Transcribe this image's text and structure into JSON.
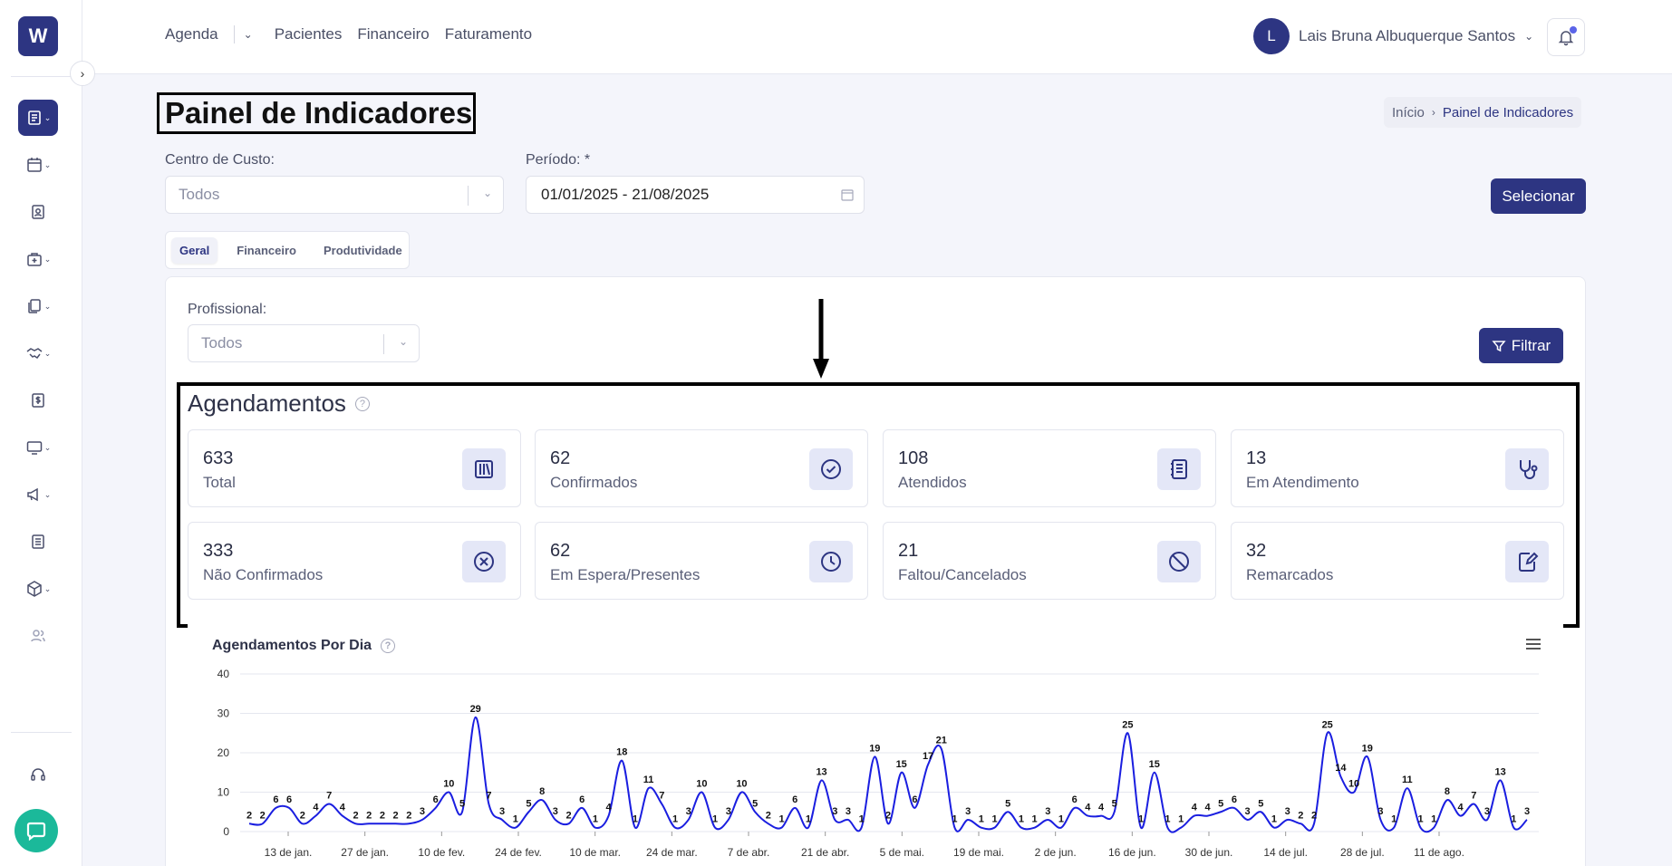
{
  "app": {
    "logo_letter": "W"
  },
  "topnav": {
    "agenda": "Agenda",
    "pacientes": "Pacientes",
    "financeiro": "Financeiro",
    "faturamento": "Faturamento"
  },
  "user": {
    "initial": "L",
    "name": "Lais Bruna Albuquerque Santos"
  },
  "page": {
    "title": "Painel de Indicadores"
  },
  "breadcrumb": {
    "home": "Início",
    "current": "Painel de Indicadores"
  },
  "filters": {
    "centro_label": "Centro de Custo:",
    "centro_value": "Todos",
    "periodo_label": "Período: *",
    "periodo_value": "01/01/2025 - 21/08/2025",
    "selecionar": "Selecionar",
    "profissional_label": "Profissional:",
    "profissional_value": "Todos",
    "filtrar": "Filtrar"
  },
  "tabs": [
    "Geral",
    "Financeiro",
    "Produtividade"
  ],
  "section": {
    "title": "Agendamentos"
  },
  "cards": [
    {
      "value": "633",
      "label": "Total",
      "icon": "books-icon"
    },
    {
      "value": "62",
      "label": "Confirmados",
      "icon": "check-circle-icon"
    },
    {
      "value": "108",
      "label": "Atendidos",
      "icon": "notebook-icon"
    },
    {
      "value": "13",
      "label": "Em Atendimento",
      "icon": "stethoscope-icon"
    },
    {
      "value": "333",
      "label": "Não Confirmados",
      "icon": "x-circle-icon"
    },
    {
      "value": "62",
      "label": "Em Espera/Presentes",
      "icon": "clock-icon"
    },
    {
      "value": "21",
      "label": "Faltou/Cancelados",
      "icon": "ban-icon"
    },
    {
      "value": "32",
      "label": "Remarcados",
      "icon": "edit-notebook-icon"
    }
  ],
  "chart_data": {
    "type": "line",
    "title": "Agendamentos Por Dia",
    "ylim": [
      0,
      40
    ],
    "yticks": [
      0,
      10,
      20,
      30,
      40
    ],
    "xticks": [
      "13 de jan.",
      "27 de jan.",
      "10 de fev.",
      "24 de fev.",
      "10 de mar.",
      "24 de mar.",
      "7 de abr.",
      "21 de abr.",
      "5 de mai.",
      "19 de mai.",
      "2 de jun.",
      "16 de jun.",
      "30 de jun.",
      "14 de jul.",
      "28 de jul.",
      "11 de ago."
    ],
    "series": [
      {
        "color": "#1a1ee0",
        "values": [
          2,
          2,
          6,
          6,
          2,
          4,
          7,
          4,
          2,
          2,
          2,
          2,
          2,
          3,
          6,
          10,
          5,
          29,
          7,
          3,
          1,
          5,
          8,
          3,
          2,
          6,
          1,
          4,
          18,
          1,
          11,
          7,
          1,
          3,
          10,
          1,
          3,
          10,
          5,
          2,
          1,
          6,
          1,
          13,
          3,
          3,
          1,
          19,
          2,
          15,
          6,
          17,
          21,
          1,
          3,
          1,
          1,
          5,
          1,
          1,
          3,
          1,
          6,
          4,
          4,
          5,
          25,
          1,
          15,
          1,
          1,
          4,
          4,
          5,
          6,
          3,
          5,
          1,
          3,
          2,
          2,
          25,
          14,
          10,
          19,
          3,
          1,
          11,
          1,
          1,
          8,
          4,
          7,
          3,
          13,
          1,
          3
        ]
      }
    ]
  }
}
